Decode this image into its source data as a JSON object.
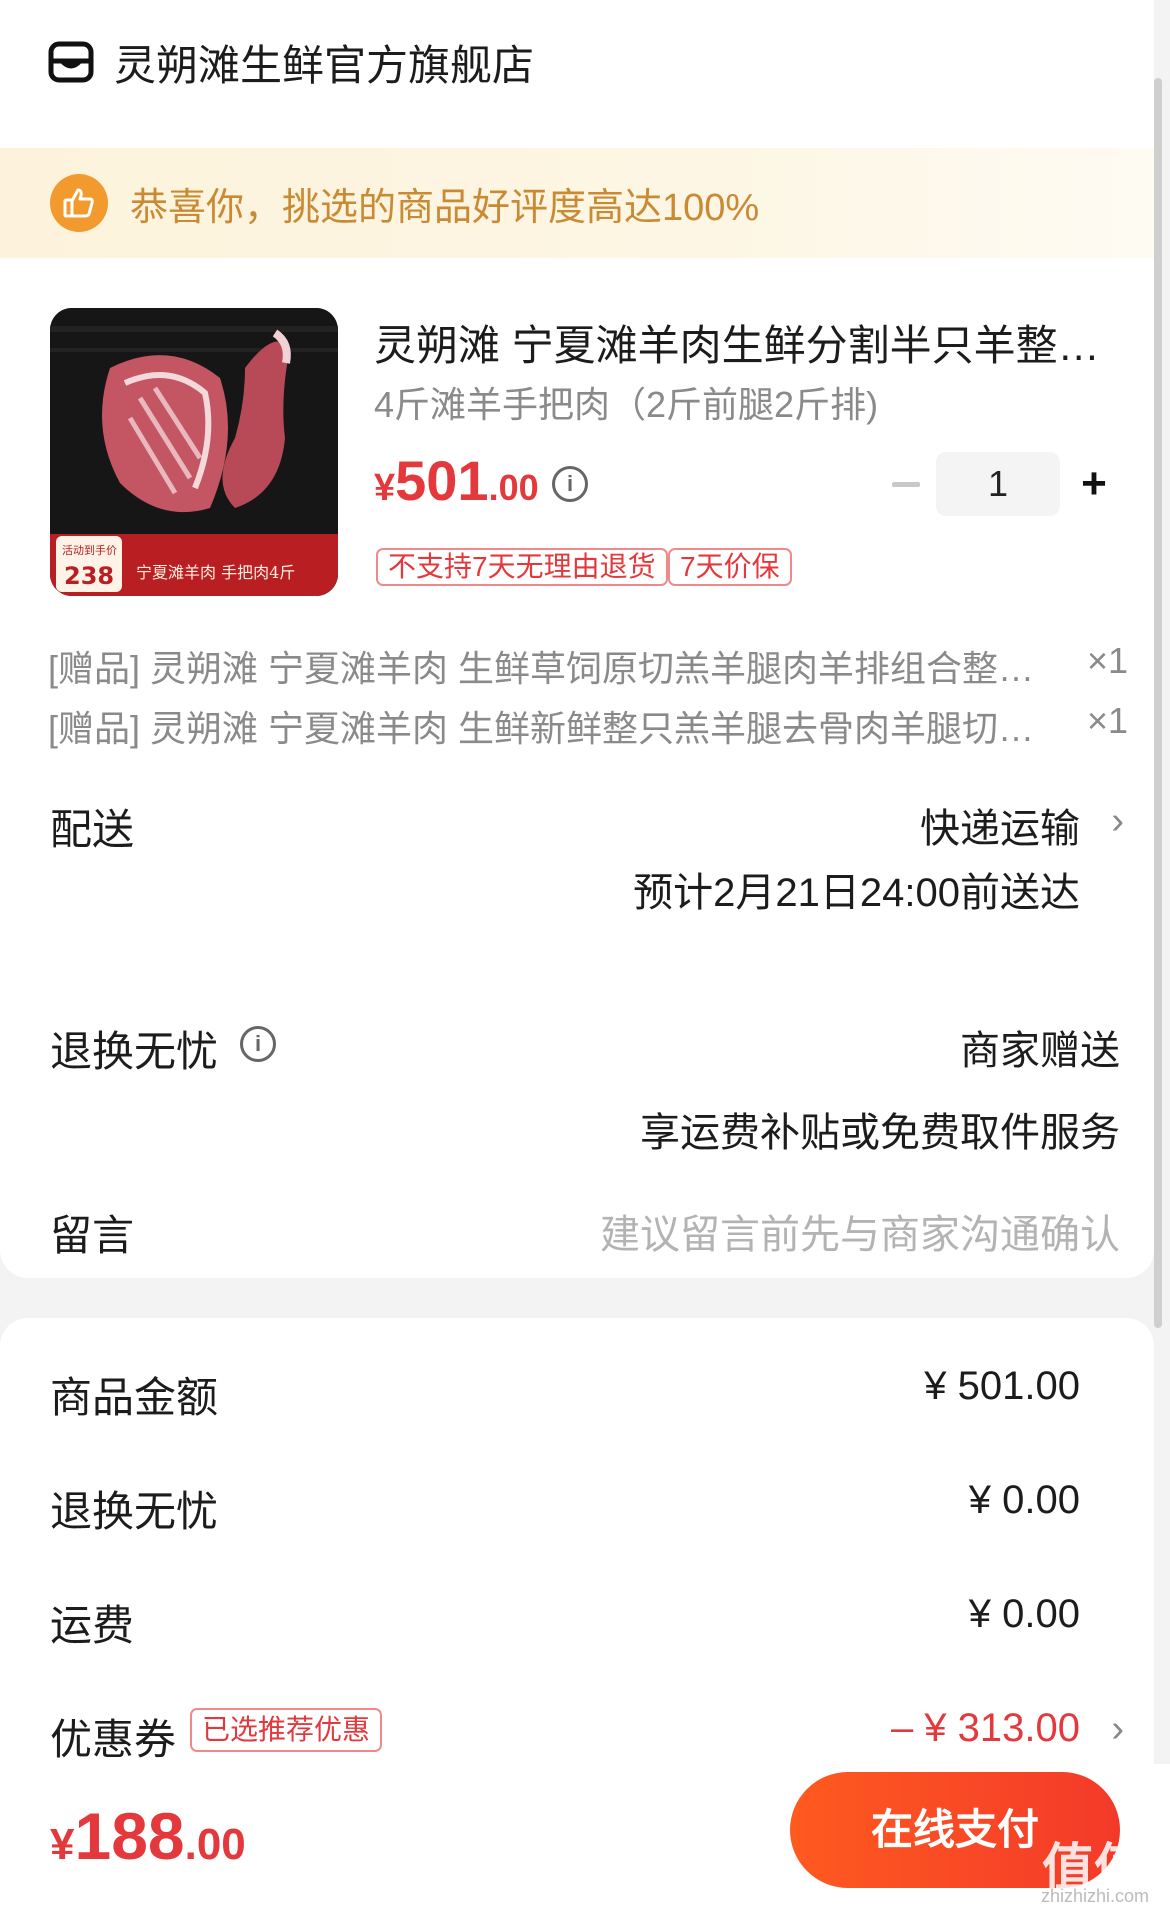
{
  "shop": {
    "name": "灵朔滩生鲜官方旗舰店"
  },
  "banner": {
    "text": "恭喜你，挑选的商品好评度高达100%"
  },
  "product": {
    "title": "灵朔滩 宁夏滩羊肉生鲜分割半只羊整…",
    "spec": "4斤滩羊手把肉（2斤前腿2斤排)",
    "price": {
      "yen": "¥",
      "int": "501",
      "dec": ".00"
    },
    "quantity": "1",
    "tags": [
      "不支持7天无理由退货",
      "7天价保"
    ],
    "image_text": {
      "price_label": "活动到手价",
      "price": "238",
      "subtitle": "宁夏滩羊肉 手把肉4斤"
    }
  },
  "gifts": [
    {
      "text": "[赠品] 灵朔滩 宁夏滩羊肉 生鲜草饲原切羔羊腿肉羊排组合整…",
      "qty": "×1"
    },
    {
      "text": "[赠品] 灵朔滩 宁夏滩羊肉 生鲜新鲜整只羔羊腿去骨肉羊腿切…",
      "qty": "×1"
    }
  ],
  "shipping": {
    "label": "配送",
    "method": "快递运输",
    "eta": "预计2月21日24:00前送达"
  },
  "returns": {
    "label": "退换无忧",
    "value": "商家赠送",
    "desc": "享运费补贴或免费取件服务"
  },
  "message": {
    "label": "留言",
    "placeholder": "建议留言前先与商家沟通确认"
  },
  "summary": [
    {
      "label": "商品金额",
      "value": "¥ 501.00"
    },
    {
      "label": "退换无忧",
      "value": "¥ 0.00"
    },
    {
      "label": "运费",
      "value": "¥ 0.00"
    }
  ],
  "coupon": {
    "label": "优惠券",
    "tag": "已选推荐优惠",
    "value": "– ¥ 313.00"
  },
  "footer": {
    "total": {
      "yen": "¥",
      "int": "188",
      "dec": ".00"
    },
    "pay_label": "在线支付",
    "watermark": "值值值",
    "watermark_sub": "zhizhizhi.com"
  },
  "colors": {
    "accent": "#e4393c",
    "pay_button": "#ff4a22",
    "banner_text": "#c98a34"
  }
}
